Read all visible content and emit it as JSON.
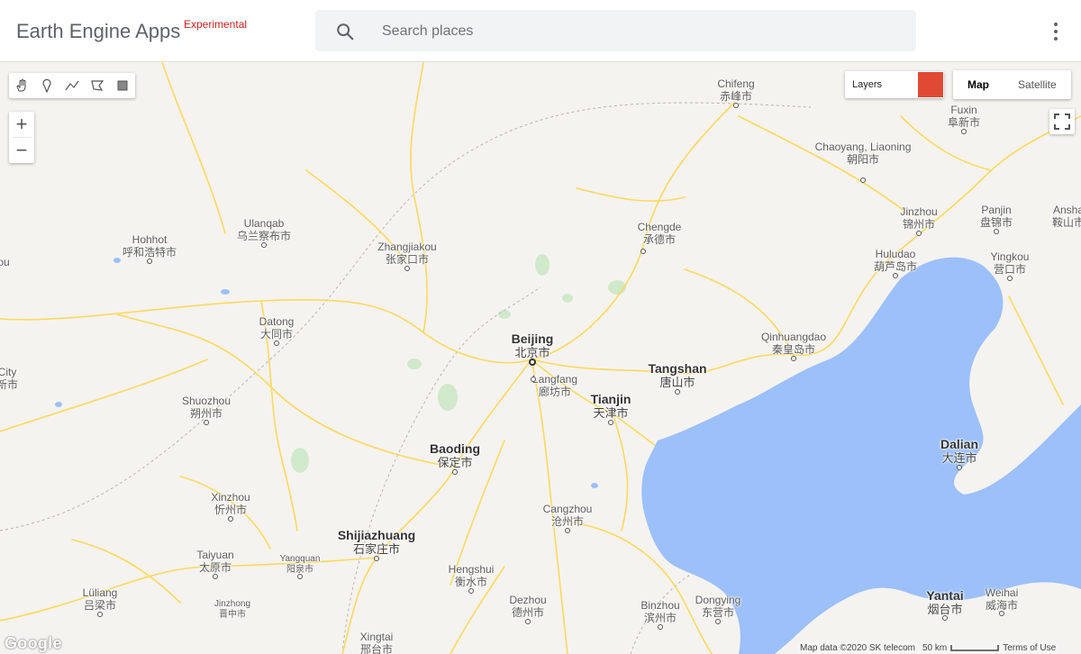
{
  "header": {
    "app_title": "Earth Engine Apps",
    "badge": "Experimental",
    "search_placeholder": "Search places",
    "menu_icon": "more-vert-icon"
  },
  "map": {
    "draw_tools": [
      "hand-pan-icon",
      "point-marker-icon",
      "line-icon",
      "polygon-icon",
      "rectangle-icon"
    ],
    "zoom_in": "+",
    "zoom_out": "−",
    "layers_label": "Layers",
    "layer_color": "#e04a35",
    "map_types": [
      "Map",
      "Satellite"
    ],
    "active_map_type": "Map",
    "google_logo": "Google",
    "attribution": {
      "data": "Map data ©2020 SK telecom",
      "scale": "50 km",
      "terms": "Terms of Use"
    },
    "water_color": "#9cc0f9",
    "road_color": "#fdd95e",
    "places": [
      {
        "en": "Chifeng",
        "zh": "赤峰市"
      },
      {
        "en": "Fuxin",
        "zh": "阜新市"
      },
      {
        "en": "Chaoyang, Liaoning",
        "zh": "朝阳市"
      },
      {
        "en": "Jinzhou",
        "zh": "锦州市"
      },
      {
        "en": "Panjin",
        "zh": "盘锦市"
      },
      {
        "en": "Ansha",
        "zh": "鞍山市"
      },
      {
        "en": "Yingkou",
        "zh": "营口市"
      },
      {
        "en": "Huludao",
        "zh": "葫芦岛市"
      },
      {
        "en": "Chengde",
        "zh": "承德市"
      },
      {
        "en": "Ulanqab",
        "zh": "乌兰察布市"
      },
      {
        "en": "Hohhot",
        "zh": "呼和浩特市"
      },
      {
        "en": "Zhangjiakou",
        "zh": "张家口市"
      },
      {
        "en": "Datong",
        "zh": "大同市"
      },
      {
        "en": "Beijing",
        "zh": "北京市"
      },
      {
        "en": "Qinhuangdao",
        "zh": "秦皇岛市"
      },
      {
        "en": "Tangshan",
        "zh": "唐山市"
      },
      {
        "en": "Langfang",
        "zh": "廊坊市"
      },
      {
        "en": "Tianjin",
        "zh": "天津市"
      },
      {
        "en": "Shuozhou",
        "zh": "朔州市"
      },
      {
        "en": "Baoding",
        "zh": "保定市"
      },
      {
        "en": "Dalian",
        "zh": "大连市"
      },
      {
        "en": "Xinzhou",
        "zh": "忻州市"
      },
      {
        "en": "Cangzhou",
        "zh": "沧州市"
      },
      {
        "en": "Shijiazhuang",
        "zh": "石家庄市"
      },
      {
        "en": "Taiyuan",
        "zh": "太原市"
      },
      {
        "en": "Yangquan",
        "zh": "阳泉市"
      },
      {
        "en": "Hengshui",
        "zh": "衡水市"
      },
      {
        "en": "Lüliang",
        "zh": "吕梁市"
      },
      {
        "en": "Jinzhong",
        "zh": "晋中市"
      },
      {
        "en": "Dezhou",
        "zh": "德州市"
      },
      {
        "en": "Binzhou",
        "zh": "滨州市"
      },
      {
        "en": "Dongying",
        "zh": "东营市"
      },
      {
        "en": "Yantai",
        "zh": "烟台市"
      },
      {
        "en": "Weihai",
        "zh": "威海市"
      },
      {
        "en": "Xingtai",
        "zh": "邢台市"
      },
      {
        "en": "ou",
        "zh": ""
      },
      {
        "en": "City",
        "zh": "新市"
      }
    ]
  }
}
